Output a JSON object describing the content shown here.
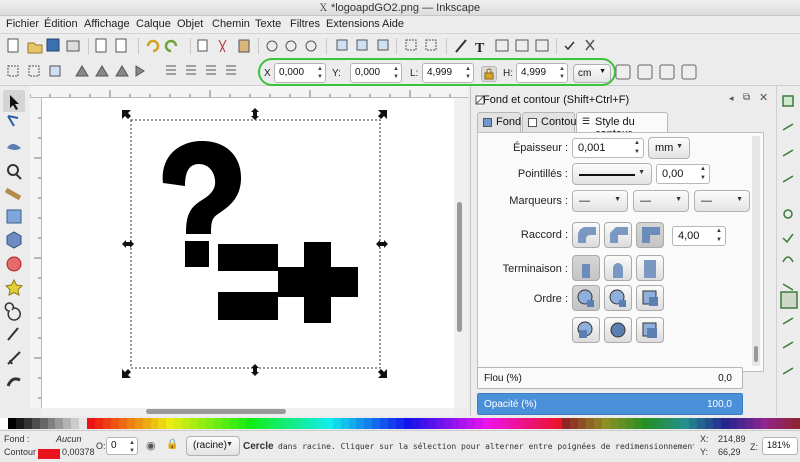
{
  "window": {
    "title": "*logoapdGO2.png — Inkscape"
  },
  "menu": [
    "Fichier",
    "Édition",
    "Affichage",
    "Calque",
    "Objet",
    "Chemin",
    "Texte",
    "Filtres",
    "Extensions",
    "Aide"
  ],
  "controls": {
    "x_label": "X",
    "x_value": "0,000",
    "y_label": "Y:",
    "y_value": "0,000",
    "w_label": "L:",
    "w_value": "4,999",
    "h_label": "H:",
    "h_value": "4,999",
    "unit": "cm"
  },
  "panel": {
    "title": "Fond et contour (Shift+Ctrl+F)",
    "tabs": [
      "Fond",
      "Contour",
      "Style du contour"
    ],
    "epaisseur_label": "Épaisseur :",
    "epaisseur_value": "0,001",
    "epaisseur_unit": "mm",
    "pointilles_label": "Pointillés :",
    "pointilles_offset": "0,00",
    "marqueurs_label": "Marqueurs :",
    "marqueur_value": "—",
    "raccord_label": "Raccord :",
    "raccord_value": "4,00",
    "terminaison_label": "Terminaison :",
    "ordre_label": "Ordre :",
    "flou_label": "Flou (%)",
    "flou_value": "0,0",
    "opacite_label": "Opacité (%)",
    "opacite_value": "100,0",
    "opacite_fraction": 1.0
  },
  "status": {
    "fond_label": "Fond :",
    "fond_value": "Aucun",
    "contour_label": "Contour :",
    "contour_width": "0,00378",
    "o_label": "O:",
    "o_value": "0",
    "layer": "(racine)",
    "message_bold": "Cercle",
    "message": "dans racine. Cliquer sur la sélection pour alterner entre poignées de redimensionnement et de r...",
    "x_label": "X:",
    "x_coord": "214,89",
    "y_label": "Y:",
    "y_coord": "66,29",
    "z_label": "Z:",
    "zoom": "181%"
  },
  "colors": {
    "accent": "#4a90d9",
    "oval": "#39c439",
    "contour": "#e8141e"
  }
}
